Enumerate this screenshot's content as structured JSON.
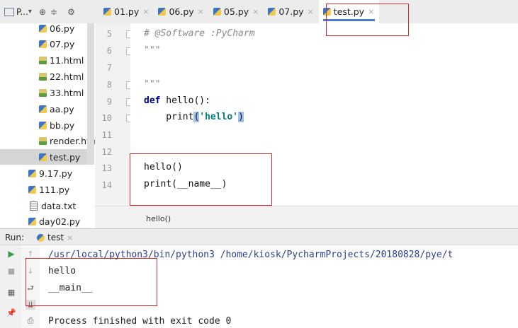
{
  "project_header": {
    "label": "P...",
    "dropdown": "▾",
    "icons": [
      "project-icon",
      "target-icon",
      "collapse-icon",
      "gear-icon"
    ]
  },
  "tabs": [
    {
      "label": "01.py",
      "active": false
    },
    {
      "label": "06.py",
      "active": false
    },
    {
      "label": "05.py",
      "active": false
    },
    {
      "label": "07.py",
      "active": false
    },
    {
      "label": "test.py",
      "active": true
    }
  ],
  "close_glyph": "×",
  "tree": [
    {
      "label": "06.py",
      "type": "py",
      "indent": 2
    },
    {
      "label": "07.py",
      "type": "py",
      "indent": 2
    },
    {
      "label": "11.html",
      "type": "html",
      "indent": 2
    },
    {
      "label": "22.html",
      "type": "html",
      "indent": 2
    },
    {
      "label": "33.html",
      "type": "html",
      "indent": 2
    },
    {
      "label": "aa.py",
      "type": "py",
      "indent": 2
    },
    {
      "label": "bb.py",
      "type": "py",
      "indent": 2
    },
    {
      "label": "render.htm",
      "type": "html",
      "indent": 2
    },
    {
      "label": "test.py",
      "type": "py",
      "indent": 2,
      "selected": true
    },
    {
      "label": "9.17.py",
      "type": "py",
      "indent": 1
    },
    {
      "label": "111.py",
      "type": "py",
      "indent": 1
    },
    {
      "label": "data.txt",
      "type": "txt",
      "indent": 1
    },
    {
      "label": "day02.py",
      "type": "py",
      "indent": 1
    }
  ],
  "editor": {
    "lines": [
      {
        "num": "5",
        "text": "# @Software :PyCharm"
      },
      {
        "num": "6",
        "text": "\"\"\""
      },
      {
        "num": "7",
        "text": ""
      },
      {
        "num": "8",
        "text": "\"\"\""
      },
      {
        "num": "9",
        "kw": "def",
        "text": " hello():"
      },
      {
        "num": "10",
        "pre": "    print",
        "paren_open": "(",
        "str": "'hello'",
        "paren_close": ")"
      },
      {
        "num": "11",
        "text": ""
      },
      {
        "num": "12",
        "text": ""
      },
      {
        "num": "13",
        "text": "hello()"
      },
      {
        "num": "14",
        "text": "print(__name__)"
      }
    ],
    "highlight_color": "#fcf6d8"
  },
  "breadcrumb": "hello()",
  "run": {
    "label": "Run:",
    "tab": "test",
    "console": [
      "/usr/local/python3/bin/python3 /home/kiosk/PycharmProjects/20180828/pye/t",
      "hello",
      "__main__",
      "",
      "Process finished with exit code 0"
    ]
  },
  "colors": {
    "annotation": "#d62828",
    "tab_underline": "#4a7bd0",
    "keyword": "#000080",
    "string": "#008080"
  }
}
